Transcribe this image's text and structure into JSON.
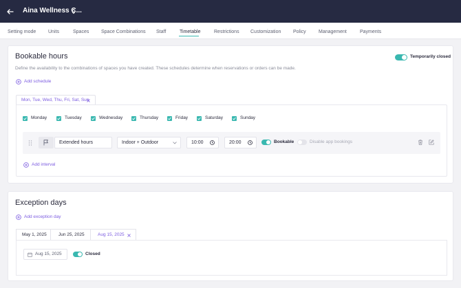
{
  "header": {
    "venue_name": "Aina Wellness C..."
  },
  "nav": {
    "tabs": [
      {
        "label": "Setting mode"
      },
      {
        "label": "Units"
      },
      {
        "label": "Spaces"
      },
      {
        "label": "Space Combinations"
      },
      {
        "label": "Staff"
      },
      {
        "label": "Timetable",
        "active": true
      },
      {
        "label": "Restrictions"
      },
      {
        "label": "Customization"
      },
      {
        "label": "Policy"
      },
      {
        "label": "Management"
      },
      {
        "label": "Payments"
      }
    ]
  },
  "bookable": {
    "title": "Bookable hours",
    "description": "Define the availability to the combinations of spaces you have created. These schedules determine when reservations or orders can be made.",
    "temporarily_closed_label": "Temporarily closed",
    "temporarily_closed": true,
    "add_schedule_label": "Add schedule",
    "schedule_tab_label": "Mon, Tue, Wed, Thu, Fri, Sat, Sun",
    "days": [
      {
        "label": "Monday",
        "checked": true
      },
      {
        "label": "Tuesday",
        "checked": true
      },
      {
        "label": "Wednesday",
        "checked": true
      },
      {
        "label": "Thursday",
        "checked": true
      },
      {
        "label": "Friday",
        "checked": true
      },
      {
        "label": "Saturday",
        "checked": true
      },
      {
        "label": "Sunday",
        "checked": true
      }
    ],
    "interval": {
      "name": "Extended hours",
      "space": "Indoor + Outdoor",
      "start": "10:00",
      "end": "20:00",
      "bookable_label": "Bookable",
      "bookable": true,
      "disable_app_label": "Disable app bookings",
      "disable_app": false
    },
    "add_interval_label": "Add interval"
  },
  "exceptions": {
    "title": "Exception days",
    "add_label": "Add exception day",
    "tabs": [
      {
        "label": "May 1, 2025"
      },
      {
        "label": "Jun 25, 2025"
      },
      {
        "label": "Aug 15, 2025",
        "active": true
      }
    ],
    "date_value": "Aug 15, 2025",
    "closed_label": "Closed",
    "closed": true
  },
  "colors": {
    "accent": "#3ab8b0",
    "link": "#7c5ce0",
    "header_bg": "#262a42"
  }
}
